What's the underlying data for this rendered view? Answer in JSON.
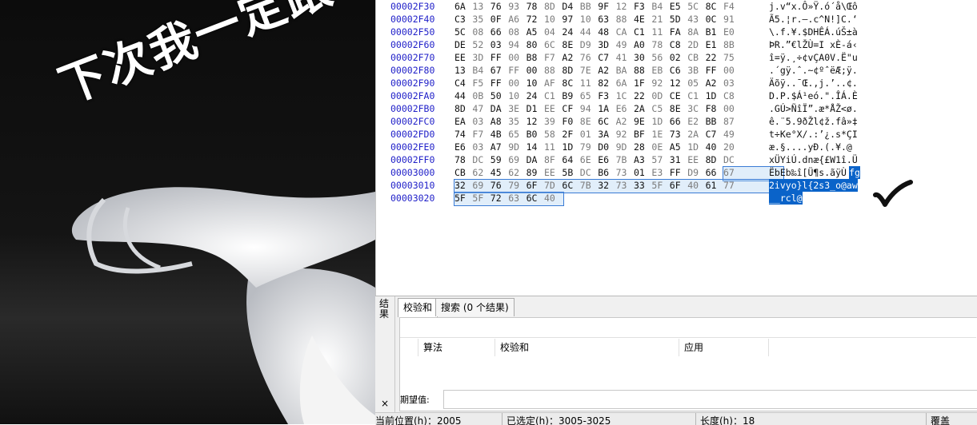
{
  "meme": {
    "caption": "下次我一定跟"
  },
  "hex_editor": {
    "rows": [
      {
        "addr": "00002F30",
        "bytes": [
          "6A",
          "13",
          "76",
          "93",
          "78",
          "8D",
          "D4",
          "BB",
          "9F",
          "12",
          "F3",
          "B4",
          "E5",
          "5C",
          "8C",
          "F4"
        ],
        "ascii": "j.v“x.Ô»Ÿ.ó´å\\Œô"
      },
      {
        "addr": "00002F40",
        "bytes": [
          "C3",
          "35",
          "0F",
          "A6",
          "72",
          "10",
          "97",
          "10",
          "63",
          "88",
          "4E",
          "21",
          "5D",
          "43",
          "0C",
          "91"
        ],
        "ascii": "Ã5.¦r.—.c^N!]C.‘"
      },
      {
        "addr": "00002F50",
        "bytes": [
          "5C",
          "08",
          "66",
          "08",
          "A5",
          "04",
          "24",
          "44",
          "48",
          "CA",
          "C1",
          "11",
          "FA",
          "8A",
          "B1",
          "E0"
        ],
        "ascii": "\\.f.¥.$DHÊÁ.úŠ±à"
      },
      {
        "addr": "00002F60",
        "bytes": [
          "DE",
          "52",
          "03",
          "94",
          "80",
          "6C",
          "8E",
          "D9",
          "3D",
          "49",
          "A0",
          "78",
          "C8",
          "2D",
          "E1",
          "8B"
        ],
        "ascii": "ÞR.”€lŽÙ=I xÈ-á‹"
      },
      {
        "addr": "00002F70",
        "bytes": [
          "EE",
          "3D",
          "FF",
          "00",
          "B8",
          "F7",
          "A2",
          "76",
          "C7",
          "41",
          "30",
          "56",
          "02",
          "CB",
          "22",
          "75"
        ],
        "ascii": "î=ÿ.¸÷¢vÇA0V.Ë\"u"
      },
      {
        "addr": "00002F80",
        "bytes": [
          "13",
          "B4",
          "67",
          "FF",
          "00",
          "88",
          "8D",
          "7E",
          "A2",
          "BA",
          "88",
          "EB",
          "C6",
          "3B",
          "FF",
          "00"
        ],
        "ascii": ".´gÿ.ˆ.~¢ºˆëÆ;ÿ."
      },
      {
        "addr": "00002F90",
        "bytes": [
          "C4",
          "F5",
          "FF",
          "00",
          "10",
          "AF",
          "8C",
          "11",
          "82",
          "6A",
          "1F",
          "92",
          "12",
          "05",
          "A2",
          "03"
        ],
        "ascii": "Äõÿ..¯Œ.‚j.’..¢."
      },
      {
        "addr": "00002FA0",
        "bytes": [
          "44",
          "0B",
          "50",
          "10",
          "24",
          "C1",
          "B9",
          "65",
          "F3",
          "1C",
          "22",
          "0D",
          "CE",
          "C1",
          "1D",
          "C8"
        ],
        "ascii": "D.P.$Á¹eó.\".ÎÁ.È"
      },
      {
        "addr": "00002FB0",
        "bytes": [
          "8D",
          "47",
          "DA",
          "3E",
          "D1",
          "EE",
          "CF",
          "94",
          "1A",
          "E6",
          "2A",
          "C5",
          "8E",
          "3C",
          "F8",
          "00"
        ],
        "ascii": ".GÚ>ÑîÏ”.æ*ÅŽ<ø."
      },
      {
        "addr": "00002FC0",
        "bytes": [
          "EA",
          "03",
          "A8",
          "35",
          "12",
          "39",
          "F0",
          "8E",
          "6C",
          "A2",
          "9E",
          "1D",
          "66",
          "E2",
          "BB",
          "87"
        ],
        "ascii": "ê.¨5.9ðŽl¢ž.fâ»‡"
      },
      {
        "addr": "00002FD0",
        "bytes": [
          "74",
          "F7",
          "4B",
          "65",
          "B0",
          "58",
          "2F",
          "01",
          "3A",
          "92",
          "BF",
          "1E",
          "73",
          "2A",
          "C7",
          "49"
        ],
        "ascii": "t÷Ke°X/.:’¿.s*ÇI"
      },
      {
        "addr": "00002FE0",
        "bytes": [
          "E6",
          "03",
          "A7",
          "9D",
          "14",
          "11",
          "1D",
          "79",
          "D0",
          "9D",
          "28",
          "0E",
          "A5",
          "1D",
          "40",
          "20"
        ],
        "ascii": "æ.§....yÐ.(.¥.@ "
      },
      {
        "addr": "00002FF0",
        "bytes": [
          "78",
          "DC",
          "59",
          "69",
          "DA",
          "8F",
          "64",
          "6E",
          "E6",
          "7B",
          "A3",
          "57",
          "31",
          "EE",
          "8D",
          "DC"
        ],
        "ascii": "xÜYiÚ.dnæ{£W1î.Ü"
      },
      {
        "addr": "00003000",
        "bytes": [
          "CB",
          "62",
          "45",
          "62",
          "89",
          "EE",
          "5B",
          "DC",
          "B6",
          "73",
          "01",
          "E3",
          "FF",
          "D9",
          "66",
          "67"
        ],
        "ascii_plain": "ËbEb‰î[Ü¶s.ãÿÙ",
        "ascii_sel": "fg"
      },
      {
        "addr": "00003010",
        "bytes": [
          "32",
          "69",
          "76",
          "79",
          "6F",
          "7D",
          "6C",
          "7B",
          "32",
          "73",
          "33",
          "5F",
          "6F",
          "40",
          "61",
          "77"
        ],
        "ascii_sel": "2ivyo}l{2s3_o@aw"
      },
      {
        "addr": "00003020",
        "bytes": [
          "5F",
          "5F",
          "72",
          "63",
          "6C",
          "40"
        ],
        "ascii_sel": "__rcl@"
      }
    ]
  },
  "results": {
    "side_label": "结果",
    "close_glyph": "×",
    "tabs": [
      {
        "label": "校验和"
      },
      {
        "label": "搜索 (0 个结果)"
      }
    ],
    "columns": [
      "算法",
      "校验和",
      "应用"
    ],
    "expected_label": "期望值:",
    "expected_value": ""
  },
  "status": {
    "cursor": "当前位置(h)：2005",
    "selection": "已选定(h)：3005-3025",
    "length": "长度(h)：18",
    "mode": "覆盖"
  }
}
